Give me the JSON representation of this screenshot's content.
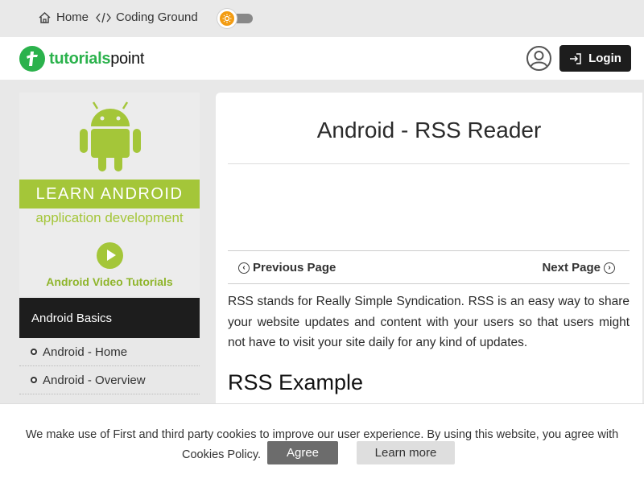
{
  "topbar": {
    "home_label": "Home",
    "coding_ground_label": "Coding Ground"
  },
  "header": {
    "logo_part1": "tutorials",
    "logo_part2": "point",
    "login_label": "Login"
  },
  "sidebar": {
    "promo": {
      "band_text": "LEARN ANDROID",
      "sub_text": "application development",
      "video_label": "Android Video Tutorials"
    },
    "section_title": "Android Basics",
    "items": [
      {
        "label": "Android - Home"
      },
      {
        "label": "Android - Overview"
      }
    ]
  },
  "main": {
    "title": "Android - RSS Reader",
    "prev_label": "Previous Page",
    "next_label": "Next Page",
    "intro": "RSS stands for Really Simple Syndication. RSS is an easy way to share your website updates and content with your users so that users might not have to visit your site daily for any kind of updates.",
    "section_heading": "RSS Example"
  },
  "cookie": {
    "message_line1": "We make use of First and third party cookies to improve our user experience. By using this website, you agree with our",
    "message_line2": "Cookies Policy.",
    "agree_label": "Agree",
    "learn_more_label": "Learn more"
  },
  "colors": {
    "brand_green": "#2bb24c",
    "android_green": "#a4c639",
    "dark": "#1d1d1d",
    "toggle_accent": "#f39c12"
  }
}
